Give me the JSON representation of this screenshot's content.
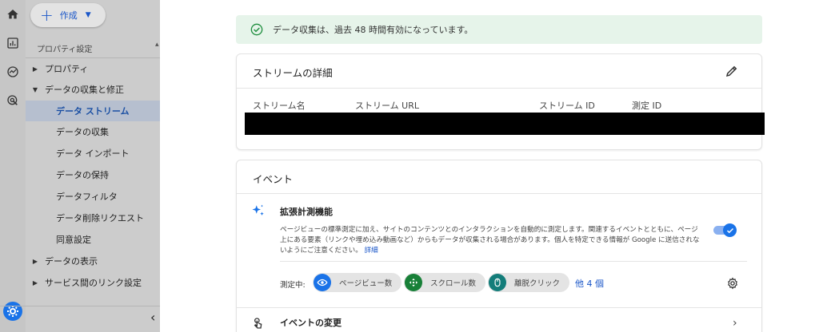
{
  "rail": {
    "icons": [
      "home-icon",
      "reports-icon",
      "explore-icon",
      "advertising-icon"
    ],
    "bottom_icon": "admin-gear-icon",
    "accent": "#1a73e8"
  },
  "sidebar": {
    "create_label": "作成",
    "section_title": "プロパティ設定",
    "items": [
      {
        "label": "プロパティ",
        "level": 0,
        "expanded": false
      },
      {
        "label": "データの収集と修正",
        "level": 0,
        "expanded": true
      },
      {
        "label": "データ ストリーム",
        "level": 1,
        "active": true
      },
      {
        "label": "データの収集",
        "level": 1
      },
      {
        "label": "データ インポート",
        "level": 1
      },
      {
        "label": "データの保持",
        "level": 1
      },
      {
        "label": "データフィルタ",
        "level": 1
      },
      {
        "label": "データ削除リクエスト",
        "level": 1
      },
      {
        "label": "同意設定",
        "level": 1
      },
      {
        "label": "データの表示",
        "level": 0,
        "expanded": false
      },
      {
        "label": "サービス間のリンク設定",
        "level": 0,
        "expanded": false
      }
    ]
  },
  "notice": {
    "text": "データ収集は、過去 48 時間有効になっています。",
    "color": "#1e8e3e"
  },
  "stream_details": {
    "title": "ストリームの詳細",
    "columns": [
      "ストリーム名",
      "ストリーム URL",
      "ストリーム ID",
      "測定 ID"
    ]
  },
  "events": {
    "title": "イベント",
    "enhanced": {
      "title": "拡張計測機能",
      "description": "ページビューの標準測定に加え、サイトのコンテンツとのインタラクションを自動的に測定します。関連するイベントとともに、ページ上にある要素（リンクや埋め込み動画など）からもデータが収集される場合があります。個人を特定できる情報が Google に送信されないようにご注意ください。",
      "link": "詳細",
      "enabled": true
    },
    "measuring_label": "測定中:",
    "chips": [
      {
        "label": "ページビュー数",
        "icon": "eye-icon",
        "color": "#1a73e8"
      },
      {
        "label": "スクロール数",
        "icon": "scroll-icon",
        "color": "#188038"
      },
      {
        "label": "離脱クリック",
        "icon": "mouse-icon",
        "color": "#137d7a"
      }
    ],
    "more_link": "他 4 個",
    "modify_events": "イベントの変更"
  }
}
